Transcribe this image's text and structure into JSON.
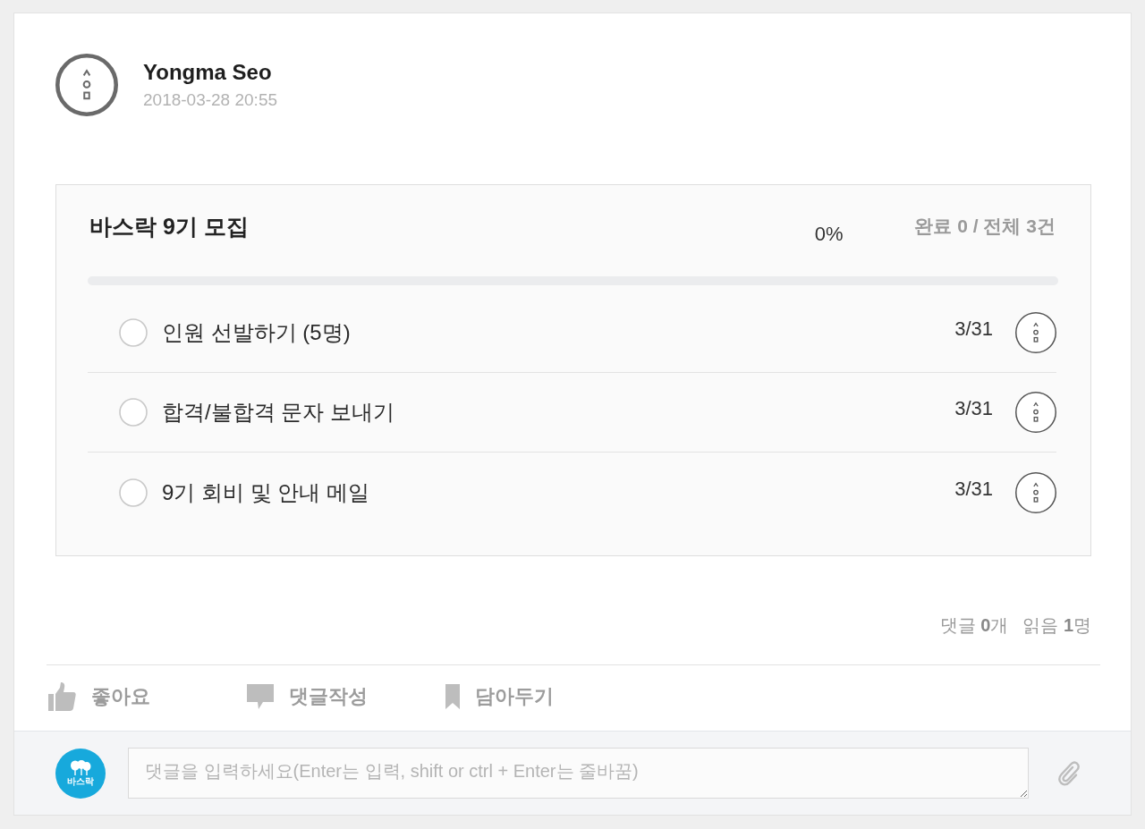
{
  "post": {
    "author": "Yongma Seo",
    "timestamp": "2018-03-28 20:55"
  },
  "checklist": {
    "title": "바스락 9기 모집",
    "progress": {
      "reading": "0%",
      "level": 0
    },
    "summary": "완료 0 / 전체 3건",
    "items": [
      {
        "label": "인원 선발하기 (5명)",
        "checked": false,
        "due": "3/31"
      },
      {
        "label": "합격/불합격 문자 보내기",
        "checked": false,
        "due": "3/31"
      },
      {
        "label": "9기 회비 및 안내 메일",
        "checked": false,
        "due": "3/31"
      }
    ]
  },
  "stats": [
    "댓글 **0**개",
    "읽음 **1**명"
  ],
  "actions": [
    {
      "kind": "like",
      "label": "좋아요"
    },
    {
      "kind": "comment",
      "label": "댓글작성"
    },
    {
      "kind": "bookmark",
      "label": "담아두기"
    }
  ],
  "comment_box": {
    "avatar_label": "바스락",
    "placeholder": "댓글을 입력하세요(Enter는 입력, shift or ctrl + Enter는 줄바꿈)"
  }
}
